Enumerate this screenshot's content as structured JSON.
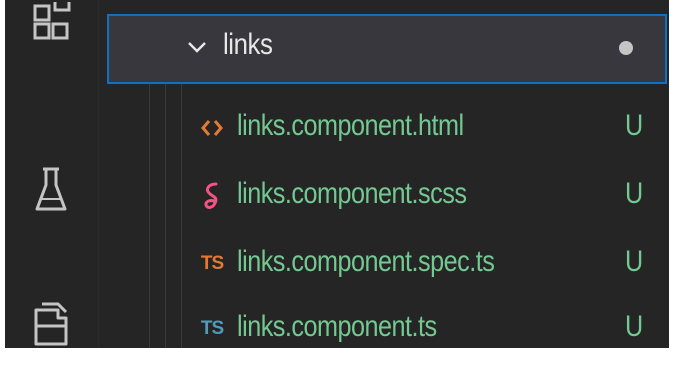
{
  "activity_bar": {
    "icons": [
      "extensions-icon",
      "testing-flask-icon",
      "explorer-files-icon"
    ]
  },
  "explorer": {
    "folder": {
      "name": "links",
      "expanded": true,
      "has_modified_files": true
    },
    "files": [
      {
        "name": "links.component.html",
        "icon": "html-file-icon",
        "icon_glyph": "‹›",
        "icon_color": "#e37933",
        "status": "U"
      },
      {
        "name": "links.component.scss",
        "icon": "sass-file-icon",
        "icon_glyph": "𝓈",
        "icon_color": "#f55385",
        "status": "U"
      },
      {
        "name": "links.component.spec.ts",
        "icon": "typescript-spec-file-icon",
        "icon_glyph": "TS",
        "icon_color": "#e37933",
        "status": "U"
      },
      {
        "name": "links.component.ts",
        "icon": "typescript-file-icon",
        "icon_glyph": "TS",
        "icon_color": "#519aba",
        "status": "U"
      }
    ]
  },
  "colors": {
    "untracked_text": "#73c991",
    "selection_border": "#0e70c0",
    "selection_background": "#37373d",
    "sidebar_background": "#252526"
  }
}
